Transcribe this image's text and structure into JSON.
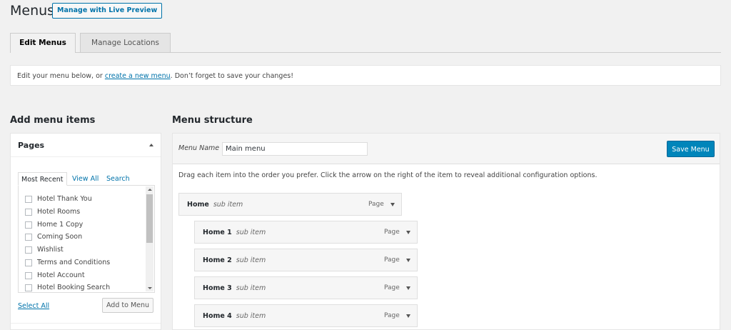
{
  "header": {
    "title": "Menus",
    "live_preview_label": "Manage with Live Preview"
  },
  "tabs": [
    {
      "label": "Edit Menus",
      "active": true
    },
    {
      "label": "Manage Locations",
      "active": false
    }
  ],
  "notice": {
    "before": "Edit your menu below, or ",
    "link": "create a new menu",
    "after": ". Don’t forget to save your changes!"
  },
  "sidebar": {
    "title": "Add menu items",
    "pages": {
      "title": "Pages",
      "tabs": [
        "Most Recent",
        "View All",
        "Search"
      ],
      "items": [
        "Hotel Thank You",
        "Hotel Rooms",
        "Home 1 Copy",
        "Coming Soon",
        "Wishlist",
        "Terms and Conditions",
        "Hotel Account",
        "Hotel Booking Search"
      ],
      "select_all": "Select All",
      "add_button": "Add to Menu"
    }
  },
  "menu_structure": {
    "title": "Menu structure",
    "name_label": "Menu Name",
    "name_value": "Main menu",
    "save_label": "Save Menu",
    "instructions": "Drag each item into the order you prefer. Click the arrow on the right of the item to reveal additional configuration options.",
    "items": [
      {
        "title": "Home",
        "sub": "sub item",
        "type": "Page",
        "depth": 0
      },
      {
        "title": "Home 1",
        "sub": "sub item",
        "type": "Page",
        "depth": 1
      },
      {
        "title": "Home 2",
        "sub": "sub item",
        "type": "Page",
        "depth": 1
      },
      {
        "title": "Home 3",
        "sub": "sub item",
        "type": "Page",
        "depth": 1
      },
      {
        "title": "Home 4",
        "sub": "sub item",
        "type": "Page",
        "depth": 1
      }
    ]
  },
  "colors": {
    "accent": "#0073aa",
    "primary_button": "#0085ba",
    "background": "#f1f1f1"
  }
}
